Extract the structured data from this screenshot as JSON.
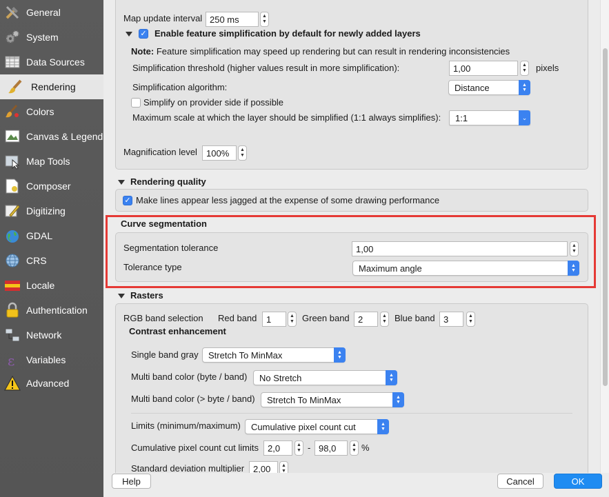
{
  "sidebar": {
    "items": [
      {
        "label": "General",
        "icon": "tools-icon"
      },
      {
        "label": "System",
        "icon": "gears-icon"
      },
      {
        "label": "Data Sources",
        "icon": "table-icon"
      },
      {
        "label": "Rendering",
        "icon": "paintbrush-icon"
      },
      {
        "label": "Colors",
        "icon": "palette-icon"
      },
      {
        "label": "Canvas & Legend",
        "icon": "canvas-icon"
      },
      {
        "label": "Map Tools",
        "icon": "map-tools-icon"
      },
      {
        "label": "Composer",
        "icon": "composer-icon"
      },
      {
        "label": "Digitizing",
        "icon": "digitizing-icon"
      },
      {
        "label": "GDAL",
        "icon": "globe-icon"
      },
      {
        "label": "CRS",
        "icon": "crs-globe-icon"
      },
      {
        "label": "Locale",
        "icon": "flag-icon"
      },
      {
        "label": "Authentication",
        "icon": "lock-icon"
      },
      {
        "label": "Network",
        "icon": "network-icon"
      },
      {
        "label": "Variables",
        "icon": "epsilon-icon"
      },
      {
        "label": "Advanced",
        "icon": "warning-icon"
      }
    ],
    "selected": "Rendering"
  },
  "rendering": {
    "map_update_interval_label": "Map update interval",
    "map_update_interval_value": "250 ms",
    "simplification_enabled_label": "Enable feature simplification by default for newly added layers",
    "note_prefix": "Note:",
    "note_text": " Feature simplification may speed up rendering but can result in rendering inconsistencies",
    "threshold_label": "Simplification threshold (higher values result in more simplification):",
    "threshold_value": "1,00",
    "threshold_unit": "pixels",
    "algorithm_label": "Simplification algorithm:",
    "algorithm_value": "Distance",
    "provider_side_label": "Simplify on provider side if possible",
    "max_scale_label": "Maximum scale at which the layer should be simplified (1:1 always simplifies):",
    "max_scale_value": "1:1",
    "magnification_label": "Magnification level",
    "magnification_value": "100%"
  },
  "rendering_quality": {
    "title": "Rendering quality",
    "jagged_label": "Make lines appear less jagged at the expense of some drawing performance"
  },
  "curve_segmentation": {
    "title": "Curve segmentation",
    "tolerance_label": "Segmentation tolerance",
    "tolerance_value": "1,00",
    "tolerance_type_label": "Tolerance type",
    "tolerance_type_value": "Maximum angle"
  },
  "rasters": {
    "title": "Rasters",
    "rgb_label": "RGB band selection",
    "red_label": "Red band",
    "red_value": "1",
    "green_label": "Green band",
    "green_value": "2",
    "blue_label": "Blue band",
    "blue_value": "3",
    "contrast_title": "Contrast enhancement",
    "single_band_label": "Single band gray",
    "single_band_value": "Stretch To MinMax",
    "multi_byte_label": "Multi band color (byte / band)",
    "multi_byte_value": "No Stretch",
    "multi_gt_byte_label": "Multi band color (> byte / band)",
    "multi_gt_byte_value": "Stretch To MinMax",
    "limits_label": "Limits (minimum/maximum)",
    "limits_value": "Cumulative pixel count cut",
    "cum_label": "Cumulative pixel count cut limits",
    "cum_min": "2,0",
    "cum_dash": "-",
    "cum_max": "98,0",
    "cum_unit": "%",
    "stddev_label": "Standard deviation multiplier",
    "stddev_value": "2,00"
  },
  "buttons": {
    "help": "Help",
    "cancel": "Cancel",
    "ok": "OK"
  },
  "colors": {
    "accent": "#3b82f0",
    "ok_button": "#1f8cf2",
    "highlight": "#e53935",
    "sidebar_bg": "#5b5b5b"
  }
}
